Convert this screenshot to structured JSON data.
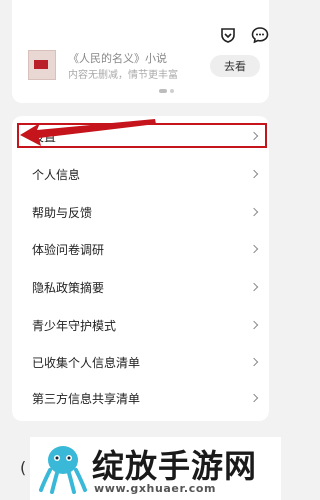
{
  "promo": {
    "book_title": "《人民的名义》小说",
    "book_subtitle": "内容无删减，情节更丰富",
    "go_button": "去看"
  },
  "settings_list": [
    {
      "label": "设置"
    },
    {
      "label": "个人信息"
    },
    {
      "label": "帮助与反馈"
    },
    {
      "label": "体验问卷调研"
    },
    {
      "label": "隐私政策摘要"
    },
    {
      "label": "青少年守护模式"
    },
    {
      "label": "已收集个人信息清单"
    },
    {
      "label": "第三方信息共享清单"
    }
  ],
  "annotation": {
    "highlight_color": "#c5141b"
  },
  "watermark": {
    "title": "绽放手游网",
    "url": "www.gxhuaer.com"
  },
  "bottom_stub": "("
}
